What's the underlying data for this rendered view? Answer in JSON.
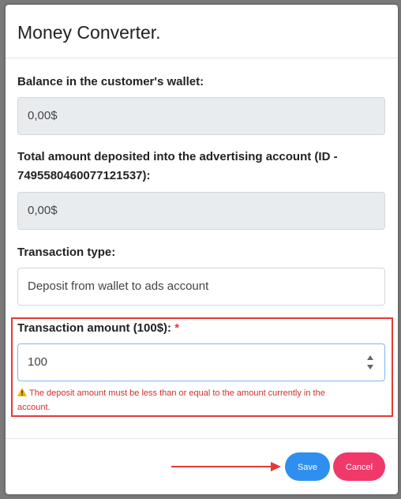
{
  "modal": {
    "title": "Money Converter."
  },
  "fields": {
    "balance": {
      "label": "Balance in the customer's wallet:",
      "value": "0,00$"
    },
    "deposited": {
      "label_line1": "Total amount deposited into the advertising account (ID -",
      "label_line2": "7495580460077121537):",
      "value": "0,00$"
    },
    "transaction_type": {
      "label": "Transaction type:",
      "value": "Deposit from wallet to ads account"
    },
    "transaction_amount": {
      "label": "Transaction amount (100$):",
      "required_mark": "*",
      "value": "100"
    }
  },
  "error": {
    "icon": "warning-icon",
    "line1": "The deposit amount must be less than or equal to the amount currently in the",
    "line2": "account."
  },
  "footer": {
    "save_label": "Save",
    "cancel_label": "Cancel"
  },
  "colors": {
    "save": "#2f8ff0",
    "cancel": "#f0386b",
    "error": "#d32f2f",
    "highlight": "#e53935"
  }
}
